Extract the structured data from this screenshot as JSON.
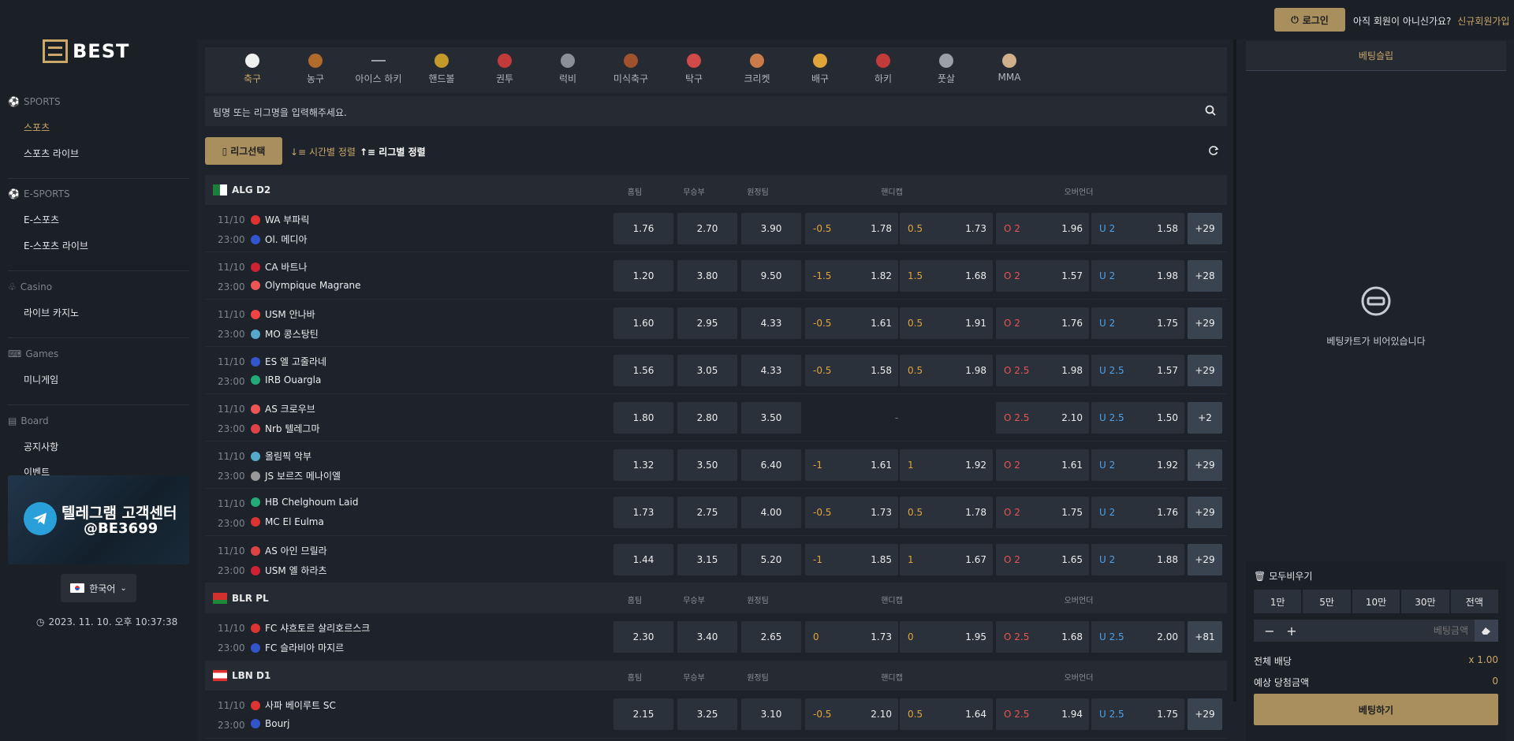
{
  "header": {
    "login_label": "로그인",
    "not_member": "아직 회원이 아니신가요?",
    "signup": "신규회원가입"
  },
  "logo_text": "BEST",
  "sidebar": {
    "sections": [
      {
        "label": "SPORTS",
        "items": [
          "스포츠",
          "스포츠 라이브"
        ]
      },
      {
        "label": "E-SPORTS",
        "items": [
          "E-스포츠",
          "E-스포츠 라이브"
        ]
      },
      {
        "label": "Casino",
        "items": [
          "라이브 카지노"
        ]
      },
      {
        "label": "Games",
        "items": [
          "미니게임"
        ]
      },
      {
        "label": "Board",
        "items": [
          "공지사항",
          "이벤트"
        ]
      }
    ],
    "banner_line1": "텔레그램 고객센터",
    "banner_line2": "@BE3699",
    "language": "한국어",
    "clock": "2023. 11. 10. 오후 10:37:38"
  },
  "sports": [
    "축구",
    "농구",
    "아이스 하키",
    "핸드볼",
    "권투",
    "럭비",
    "미식축구",
    "탁구",
    "크리켓",
    "배구",
    "하키",
    "풋살",
    "MMA"
  ],
  "search_placeholder": "팀명 또는 리그명을 입력해주세요.",
  "filters": {
    "league_select": "리그선택",
    "sort_time": "시간별 정렬",
    "sort_league": "리그별 정렬"
  },
  "columns": {
    "home": "홈팀",
    "draw": "무승부",
    "away": "원정팀",
    "handicap": "핸디캡",
    "overunder": "오버언더"
  },
  "leagues": [
    {
      "name": "ALG D2",
      "matches": [
        {
          "date": "11/10",
          "time": "23:00",
          "home": "WA 부파릭",
          "away": "Ol. 메디아",
          "h": "1.76",
          "d": "2.70",
          "a": "3.90",
          "hcl": "-0.5",
          "hco": "1.78",
          "hcl2": "0.5",
          "hco2": "1.73",
          "ol": "O 2",
          "oo": "1.96",
          "ul": "U 2",
          "uo": "1.58",
          "more": "+29"
        },
        {
          "date": "11/10",
          "time": "23:00",
          "home": "CA 바트나",
          "away": "Olympique Magrane",
          "h": "1.20",
          "d": "3.80",
          "a": "9.50",
          "hcl": "-1.5",
          "hco": "1.82",
          "hcl2": "1.5",
          "hco2": "1.68",
          "ol": "O 2",
          "oo": "1.57",
          "ul": "U 2",
          "uo": "1.98",
          "more": "+28"
        },
        {
          "date": "11/10",
          "time": "23:00",
          "home": "USM 안나바",
          "away": "MO 콩스탕틴",
          "h": "1.60",
          "d": "2.95",
          "a": "4.33",
          "hcl": "-0.5",
          "hco": "1.61",
          "hcl2": "0.5",
          "hco2": "1.91",
          "ol": "O 2",
          "oo": "1.76",
          "ul": "U 2",
          "uo": "1.75",
          "more": "+29"
        },
        {
          "date": "11/10",
          "time": "23:00",
          "home": "ES 엘 고줄라네",
          "away": "IRB Ouargla",
          "h": "1.56",
          "d": "3.05",
          "a": "4.33",
          "hcl": "-0.5",
          "hco": "1.58",
          "hcl2": "0.5",
          "hco2": "1.98",
          "ol": "O 2.5",
          "oo": "1.98",
          "ul": "U 2.5",
          "uo": "1.57",
          "more": "+29"
        },
        {
          "date": "11/10",
          "time": "23:00",
          "home": "AS 크로우브",
          "away": "Nrb 텔레그마",
          "h": "1.80",
          "d": "2.80",
          "a": "3.50",
          "hcl": "",
          "hco": "",
          "hcl2": "",
          "hco2": "",
          "nohc": "-",
          "ol": "O 2.5",
          "oo": "2.10",
          "ul": "U 2.5",
          "uo": "1.50",
          "more": "+2"
        },
        {
          "date": "11/10",
          "time": "23:00",
          "home": "올림픽 악부",
          "away": "JS 보르즈 메나이엘",
          "h": "1.32",
          "d": "3.50",
          "a": "6.40",
          "hcl": "-1",
          "hco": "1.61",
          "hcl2": "1",
          "hco2": "1.92",
          "ol": "O 2",
          "oo": "1.61",
          "ul": "U 2",
          "uo": "1.92",
          "more": "+29"
        },
        {
          "date": "11/10",
          "time": "23:00",
          "home": "HB Chelghoum Laid",
          "away": "MC El Eulma",
          "h": "1.73",
          "d": "2.75",
          "a": "4.00",
          "hcl": "-0.5",
          "hco": "1.73",
          "hcl2": "0.5",
          "hco2": "1.78",
          "ol": "O 2",
          "oo": "1.75",
          "ul": "U 2",
          "uo": "1.76",
          "more": "+29"
        },
        {
          "date": "11/10",
          "time": "23:00",
          "home": "AS 아인 므릴라",
          "away": "USM 엘 하라츠",
          "h": "1.44",
          "d": "3.15",
          "a": "5.20",
          "hcl": "-1",
          "hco": "1.85",
          "hcl2": "1",
          "hco2": "1.67",
          "ol": "O 2",
          "oo": "1.65",
          "ul": "U 2",
          "uo": "1.88",
          "more": "+29"
        }
      ]
    },
    {
      "name": "BLR PL",
      "matches": [
        {
          "date": "11/10",
          "time": "23:00",
          "home": "FC 샤흐토르 살리호르스크",
          "away": "FC 슬라비아 마지르",
          "h": "2.30",
          "d": "3.40",
          "a": "2.65",
          "hcl": "0",
          "hco": "1.73",
          "hcl2": "0",
          "hco2": "1.95",
          "ol": "O 2.5",
          "oo": "1.68",
          "ul": "U 2.5",
          "uo": "2.00",
          "more": "+81"
        }
      ]
    },
    {
      "name": "LBN D1",
      "matches": [
        {
          "date": "11/10",
          "time": "23:00",
          "home": "사파 베이루트 SC",
          "away": "Bourj",
          "h": "2.15",
          "d": "3.25",
          "a": "3.10",
          "hcl": "-0.5",
          "hco": "2.10",
          "hcl2": "0.5",
          "hco2": "1.64",
          "ol": "O 2.5",
          "oo": "1.94",
          "ul": "U 2.5",
          "uo": "1.75",
          "more": "+29"
        }
      ]
    }
  ],
  "slip": {
    "title": "베팅슬립",
    "empty": "베팅카트가 비어있습니다",
    "clear_all": "모두비우기",
    "amounts": [
      "1만",
      "5만",
      "10만",
      "30만",
      "전액"
    ],
    "stake_placeholder": "베팅금액",
    "total_odds_label": "전체 배당",
    "total_odds_value": "x 1.00",
    "expected_label": "예상 당첨금액",
    "expected_value": "0",
    "bet_button": "베팅하기"
  }
}
